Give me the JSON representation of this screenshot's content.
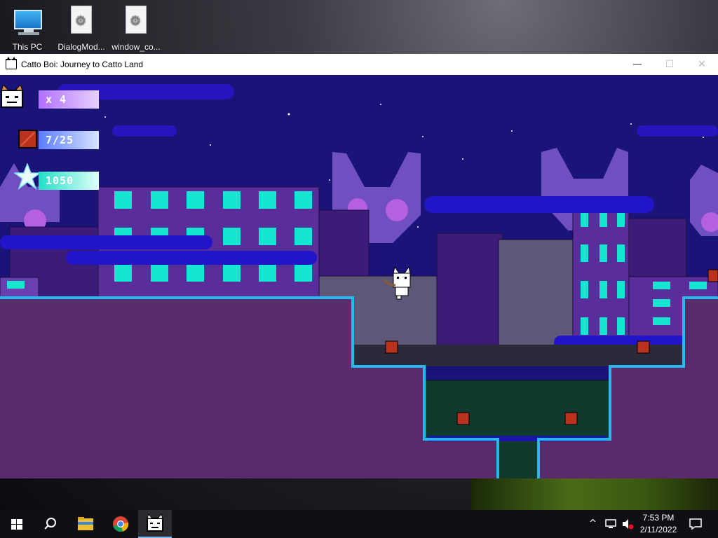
{
  "desktop": {
    "icons": [
      {
        "label": "This PC",
        "icon": "computer-icon"
      },
      {
        "label": "DialogMod...",
        "icon": "settings-file-icon"
      },
      {
        "label": "window_co...",
        "icon": "settings-file-icon"
      }
    ]
  },
  "window": {
    "title": "Catto Boi: Journey to Catto Land",
    "controls": {
      "minimize": "—",
      "maximize": "☐",
      "close": "✕"
    }
  },
  "hud": {
    "lives": "x 4",
    "crates": "7/25",
    "score": "1050"
  },
  "colors": {
    "sky": "#1a1478",
    "ground": "#5a2a6a",
    "window_cyan": "#14e6d2",
    "crate": "#b8321e"
  },
  "taskbar": {
    "pinned": [
      "windows-start-icon",
      "search-icon",
      "file-explorer-icon",
      "chrome-icon",
      "catto-game-icon"
    ],
    "clock_time": "7:53 PM",
    "clock_date": "2/11/2022"
  }
}
